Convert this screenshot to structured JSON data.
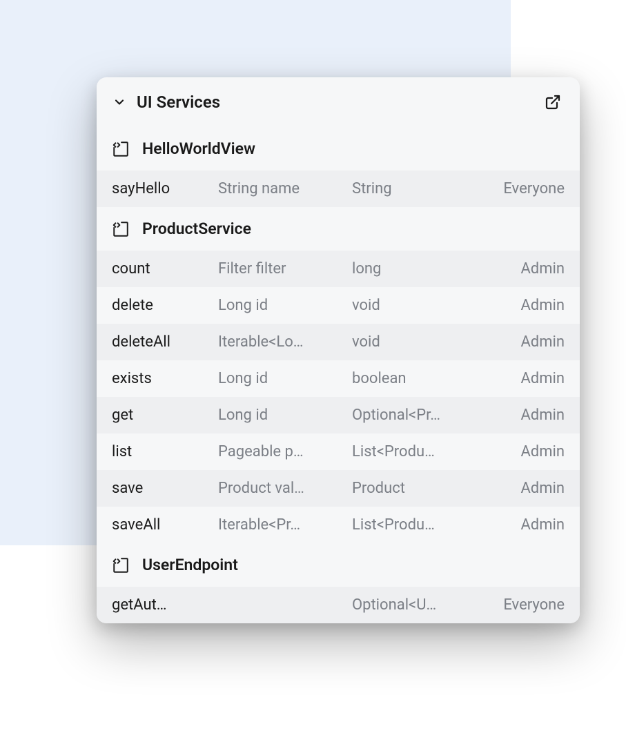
{
  "panel": {
    "title": "UI Services"
  },
  "services": [
    {
      "name": "HelloWorldView",
      "methods": [
        {
          "name": "sayHello",
          "param": "String name",
          "return": "String",
          "access": "Everyone"
        }
      ]
    },
    {
      "name": "ProductService",
      "methods": [
        {
          "name": "count",
          "param": "Filter filter",
          "return": "long",
          "access": "Admin"
        },
        {
          "name": "delete",
          "param": "Long id",
          "return": "void",
          "access": "Admin"
        },
        {
          "name": "deleteAll",
          "param": "Iterable<Lo…",
          "return": "void",
          "access": "Admin"
        },
        {
          "name": "exists",
          "param": "Long id",
          "return": "boolean",
          "access": "Admin"
        },
        {
          "name": "get",
          "param": "Long id",
          "return": "Optional<Pr…",
          "access": "Admin"
        },
        {
          "name": "list",
          "param": "Pageable p…",
          "return": "List<Produ…",
          "access": "Admin"
        },
        {
          "name": "save",
          "param": "Product val…",
          "return": "Product",
          "access": "Admin"
        },
        {
          "name": "saveAll",
          "param": "Iterable<Pr…",
          "return": "List<Produ…",
          "access": "Admin"
        }
      ]
    },
    {
      "name": "UserEndpoint",
      "methods": [
        {
          "name": "getAut…",
          "param": "",
          "return": "Optional<U…",
          "access": "Everyone"
        }
      ]
    }
  ]
}
